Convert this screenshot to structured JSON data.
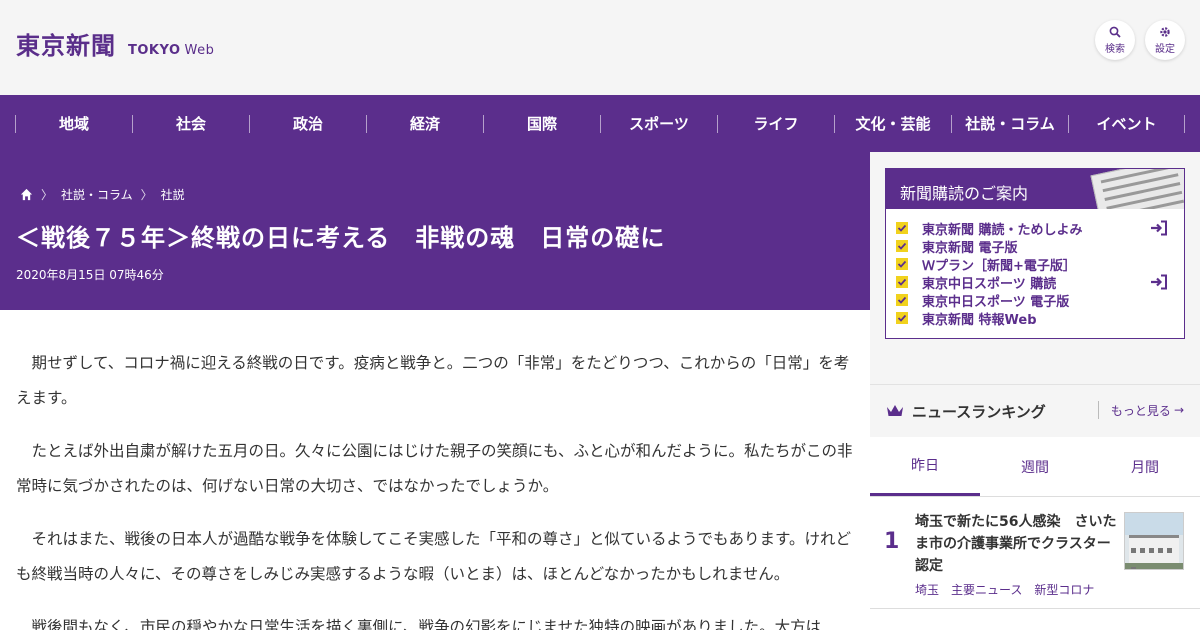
{
  "header": {
    "logo_main": "東京新聞",
    "logo_tokyo": "TOKYO",
    "logo_web": "Web",
    "search_label": "検索",
    "settings_label": "設定"
  },
  "nav": [
    "地域",
    "社会",
    "政治",
    "経済",
    "国際",
    "スポーツ",
    "ライフ",
    "文化・芸能",
    "社説・コラム",
    "イベント"
  ],
  "article": {
    "breadcrumb": [
      "社説・コラム",
      "社説"
    ],
    "title": "＜戦後７５年＞終戦の日に考える　非戦の魂　日常の礎に",
    "date": "2020年8月15日 07時46分",
    "paragraphs": [
      "期せずして、コロナ禍に迎える終戦の日です。疫病と戦争と。二つの「非常」をたどりつつ、これからの「日常」を考えます。",
      "たとえば外出自粛が解けた五月の日。久々に公園にはじけた親子の笑顔にも、ふと心が和んだように。私たちがこの非常時に気づかされたのは、何げない日常の大切さ、ではなかったでしょうか。",
      "それはまた、戦後の日本人が過酷な戦争を体験してこそ実感した「平和の尊さ」と似ているようでもあります。けれども終戦当時の人々に、その尊さをしみじみ実感するような暇（いとま）は、ほとんどなかったかもしれません。",
      "戦後間もなく、市民の穏やかな日常生活を描く裏側に、戦争の幻影をにじませた独特の映画がありました。大方は"
    ]
  },
  "sidebar": {
    "subscribe_title": "新聞購読のご案内",
    "subscribe_items": [
      {
        "label": "東京新聞 購読・ためしよみ",
        "login": true
      },
      {
        "label": "東京新聞 電子版",
        "login": false
      },
      {
        "label": "Ｗプラン［新聞+電子版］",
        "login": false
      },
      {
        "label": "東京中日スポーツ 購読",
        "login": true
      },
      {
        "label": "東京中日スポーツ 電子版",
        "login": false
      },
      {
        "label": "東京新聞 特報Web",
        "login": false
      }
    ],
    "ranking_title": "ニュースランキング",
    "ranking_more": "もっと見る",
    "tabs": [
      "昨日",
      "週間",
      "月間"
    ],
    "ranking": [
      {
        "rank": "1",
        "headline": "埼玉で新たに56人感染　さいたま市の介護事業所でクラスター認定",
        "tags": [
          "埼玉",
          "主要ニュース",
          "新型コロナ"
        ]
      }
    ]
  },
  "colors": {
    "brand": "#5b2e8c",
    "check": "#f1d21d"
  }
}
